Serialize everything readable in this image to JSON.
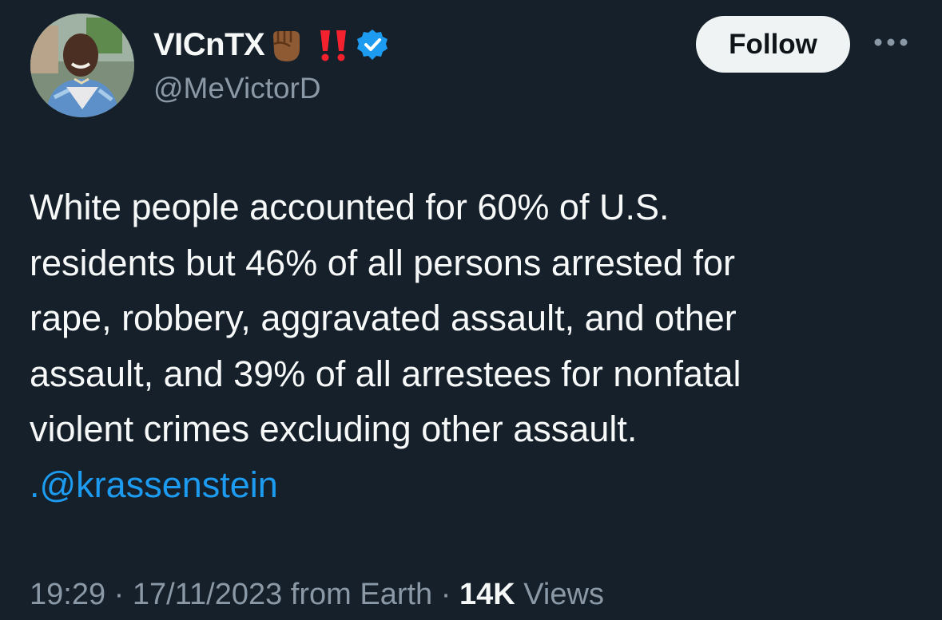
{
  "author": {
    "display_name": "VICnTX",
    "handle": "@MeVictorD",
    "badges": [
      "raised-fist-emoji",
      "double-exclamation-emoji",
      "verified-badge"
    ],
    "verified_color": "#1d9bf0"
  },
  "follow_label": "Follow",
  "tweet": {
    "lines": [
      "White people accounted for 60% of U.S.",
      "residents but 46% of all persons arrested for",
      "rape, robbery, aggravated assault, and other",
      "assault, and 39% of all arrestees for nonfatal",
      "violent crimes excluding other assault."
    ],
    "mention": ".@krassenstein"
  },
  "meta": {
    "time": "19:29",
    "sep1": " · ",
    "date": "17/11/2023",
    "source": " from Earth",
    "sep2": " · ",
    "views_count": "14K",
    "views_label": " Views"
  },
  "colors": {
    "background": "#15202b",
    "text": "#f7f9f9",
    "secondary": "#8b98a5",
    "link": "#1d9bf0",
    "follow_bg": "#eff3f4"
  }
}
